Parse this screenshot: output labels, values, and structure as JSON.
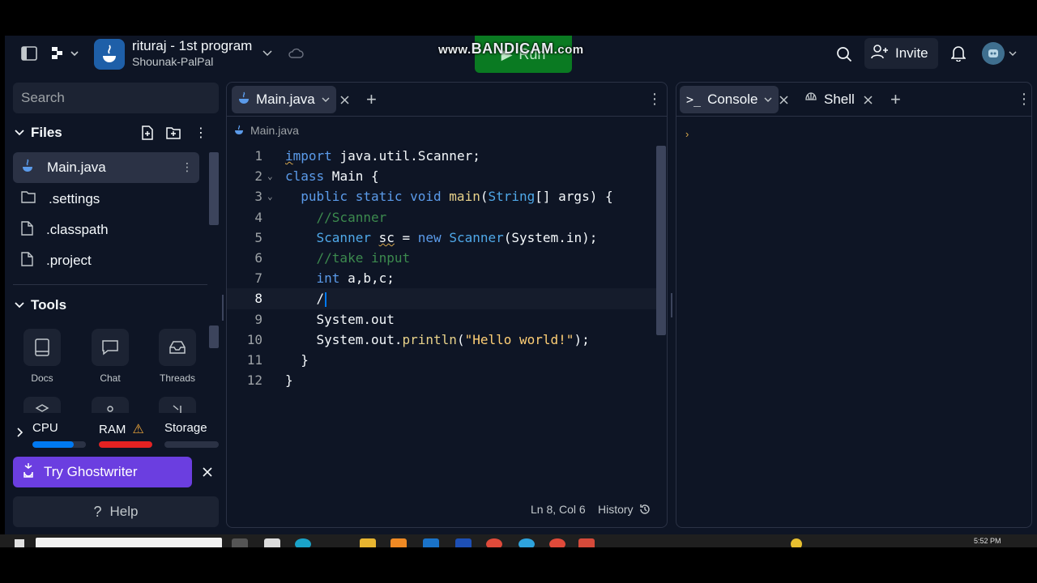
{
  "header": {
    "repl_title": "rituraj - 1st program",
    "repl_owner": "Shounak-PalPal",
    "run_label": "Run",
    "watermark": {
      "prefix": "www.",
      "brand": "BANDICAM",
      "suffix": ".com"
    },
    "invite_label": "Invite"
  },
  "sidebar": {
    "search_placeholder": "Search",
    "files_heading": "Files",
    "files": [
      {
        "name": "Main.java",
        "icon": "java-icon"
      },
      {
        "name": ".settings",
        "icon": "folder-icon"
      },
      {
        "name": ".classpath",
        "icon": "file-icon"
      },
      {
        "name": ".project",
        "icon": "file-icon"
      }
    ],
    "tools_heading": "Tools",
    "tools": [
      {
        "label": "Docs",
        "icon": "book-icon"
      },
      {
        "label": "Chat",
        "icon": "chat-icon"
      },
      {
        "label": "Threads",
        "icon": "inbox-icon"
      }
    ],
    "resources": {
      "cpu": {
        "label": "CPU",
        "usage": 0.78,
        "color": "#0079f2"
      },
      "ram": {
        "label": "RAM",
        "usage": 1.0,
        "color": "#e52222",
        "warning": true
      },
      "storage": {
        "label": "Storage",
        "usage": 0.0,
        "color": "#6c7280"
      }
    },
    "ghostwriter_label": "Try Ghostwriter",
    "help_label": "Help"
  },
  "editor": {
    "tab_label": "Main.java",
    "breadcrumb": "Main.java",
    "cursor_line": 8,
    "lines": [
      {
        "n": "1",
        "text": "import java.util.Scanner;"
      },
      {
        "n": "2",
        "text": "class Main {"
      },
      {
        "n": "3",
        "text": "  public static void main(String[] args) {"
      },
      {
        "n": "4",
        "text": "    //Scanner"
      },
      {
        "n": "5",
        "text": "    Scanner sc = new Scanner(System.in);"
      },
      {
        "n": "6",
        "text": "    //take input"
      },
      {
        "n": "7",
        "text": "    int a,b,c;"
      },
      {
        "n": "8",
        "text": "    /"
      },
      {
        "n": "9",
        "text": "    System.out"
      },
      {
        "n": "10",
        "text": "    System.out.println(\"Hello world!\");"
      },
      {
        "n": "11",
        "text": "  }"
      },
      {
        "n": "12",
        "text": "}"
      }
    ],
    "status_position": "Ln 8, Col 6",
    "history_label": "History"
  },
  "console": {
    "tabs": [
      {
        "label": "Console",
        "icon": "terminal-icon"
      },
      {
        "label": "Shell",
        "icon": "shell-icon"
      }
    ]
  },
  "colors": {
    "background": "#0e1525",
    "surface": "#1c2333",
    "run_green": "#0a7a22",
    "ghostwriter_purple": "#6b3ee0"
  }
}
